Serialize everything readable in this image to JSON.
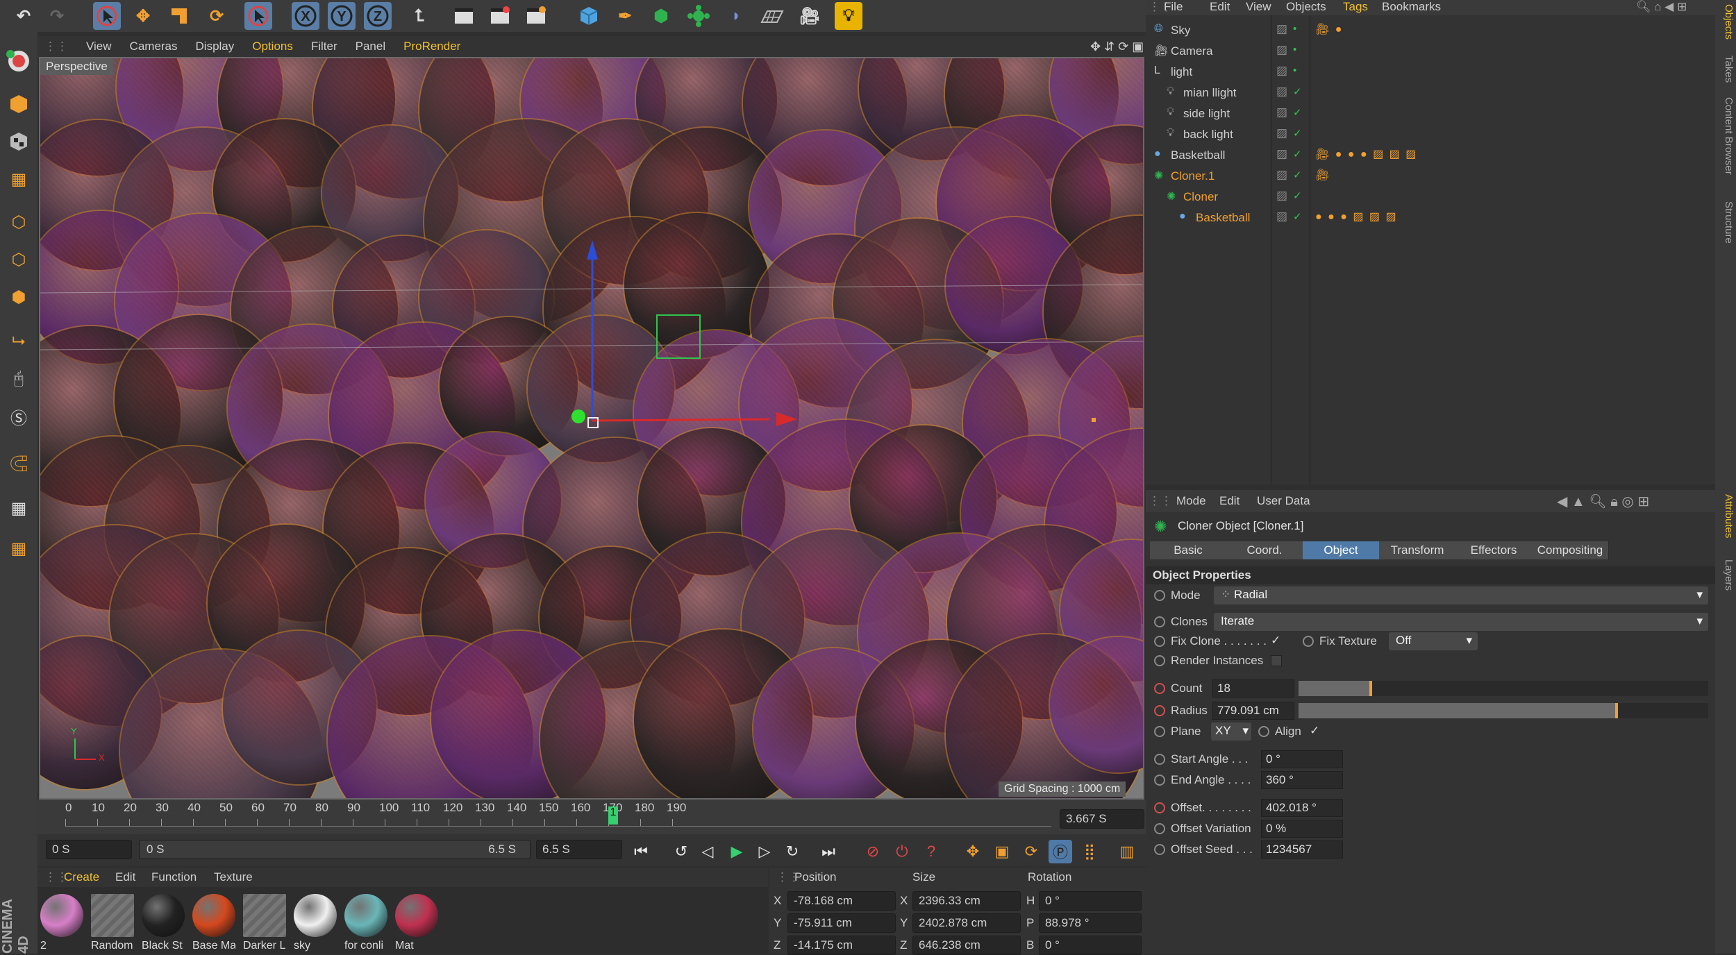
{
  "viewport": {
    "menu": [
      "View",
      "Cameras",
      "Display",
      "Options",
      "Filter",
      "Panel",
      "ProRender"
    ],
    "camera_label": "Perspective",
    "grid_spacing": "Grid Spacing : 1000 cm",
    "axis_y": "Y",
    "axis_x": "X"
  },
  "timeline": {
    "ticks": [
      "0",
      "10",
      "20",
      "30",
      "40",
      "50",
      "60",
      "70",
      "80",
      "90",
      "100",
      "110",
      "120",
      "130",
      "140",
      "150",
      "160",
      "170",
      "180",
      "190"
    ],
    "current_frame": "1",
    "current_time": "3.667 S",
    "start": "0 S",
    "range_start": "0 S",
    "range_end": "6.5 S",
    "end": "6.5 S"
  },
  "material_manager": {
    "menu": [
      "Create",
      "Edit",
      "Function",
      "Texture"
    ],
    "materials": [
      {
        "name": "2",
        "color": "#d77fc7"
      },
      {
        "name": "Random",
        "color": "#777777"
      },
      {
        "name": "Black St",
        "color": "#222222"
      },
      {
        "name": "Base Ma",
        "color": "#d5481e"
      },
      {
        "name": "Darker L",
        "color": "#777777"
      },
      {
        "name": "sky",
        "color": "#f0f0f0"
      },
      {
        "name": "for conli",
        "color": "#6ab6b8"
      },
      {
        "name": "Mat",
        "color": "#c03050"
      }
    ]
  },
  "coordinates": {
    "headers": [
      "Position",
      "Size",
      "Rotation"
    ],
    "rows": [
      {
        "axis": "X",
        "pos": "-78.168 cm",
        "size_axis": "X",
        "size": "2396.33 cm",
        "rot_axis": "H",
        "rot": "0 °"
      },
      {
        "axis": "Y",
        "pos": "-75.911 cm",
        "size_axis": "Y",
        "size": "2402.878 cm",
        "rot_axis": "P",
        "rot": "88.978 °"
      },
      {
        "axis": "Z",
        "pos": "-14.175 cm",
        "size_axis": "Z",
        "size": "646.238 cm",
        "rot_axis": "B",
        "rot": "0 °"
      }
    ]
  },
  "object_manager": {
    "menu": [
      "File",
      "Edit",
      "View",
      "Objects",
      "Tags",
      "Bookmarks"
    ],
    "objects": [
      {
        "name": "Sky",
        "indent": 0,
        "color": "#cfcfcf"
      },
      {
        "name": "Camera",
        "indent": 0,
        "color": "#cfcfcf"
      },
      {
        "name": "light",
        "indent": 0,
        "color": "#cfcfcf"
      },
      {
        "name": "mian llight",
        "indent": 1,
        "color": "#cfcfcf"
      },
      {
        "name": "side light",
        "indent": 1,
        "color": "#cfcfcf"
      },
      {
        "name": "back light",
        "indent": 1,
        "color": "#cfcfcf"
      },
      {
        "name": "Basketball",
        "indent": 0,
        "color": "#cfcfcf"
      },
      {
        "name": "Cloner.1",
        "indent": 0,
        "color": "#f0a030"
      },
      {
        "name": "Cloner",
        "indent": 1,
        "color": "#f0a030"
      },
      {
        "name": "Basketball",
        "indent": 2,
        "color": "#f0a030"
      }
    ]
  },
  "attributes": {
    "menu": [
      "Mode",
      "Edit",
      "User Data"
    ],
    "title": "Cloner Object [Cloner.1]",
    "tabs": [
      "Basic",
      "Coord.",
      "Object",
      "Transform",
      "Effectors",
      "Compositing"
    ],
    "active_tab": "Object",
    "section": "Object Properties",
    "mode_label": "Mode",
    "mode_value": "Radial",
    "clones_label": "Clones",
    "clones_value": "Iterate",
    "fix_clone_label": "Fix Clone . . . . . . .",
    "fix_texture_label": "Fix Texture",
    "fix_texture_value": "Off",
    "render_instances_label": "Render Instances",
    "count_label": "Count",
    "count_value": "18",
    "count_fraction": 0.18,
    "radius_label": "Radius",
    "radius_value": "779.091 cm",
    "radius_fraction": 0.78,
    "plane_label": "Plane",
    "plane_value": "XY",
    "align_label": "Align",
    "start_angle_label": "Start Angle . . .",
    "start_angle_value": "0 °",
    "end_angle_label": "End Angle . . . .",
    "end_angle_value": "360 °",
    "offset_label": "Offset. . . . . . . .",
    "offset_value": "402.018 °",
    "offset_var_label": "Offset Variation",
    "offset_var_value": "0 %",
    "offset_seed_label": "Offset Seed . . .",
    "offset_seed_value": "1234567"
  },
  "right_tabs": [
    "Objects",
    "Takes",
    "Content Browser",
    "Structure",
    "Attributes",
    "Layers"
  ],
  "brand": "CINEMA 4D"
}
